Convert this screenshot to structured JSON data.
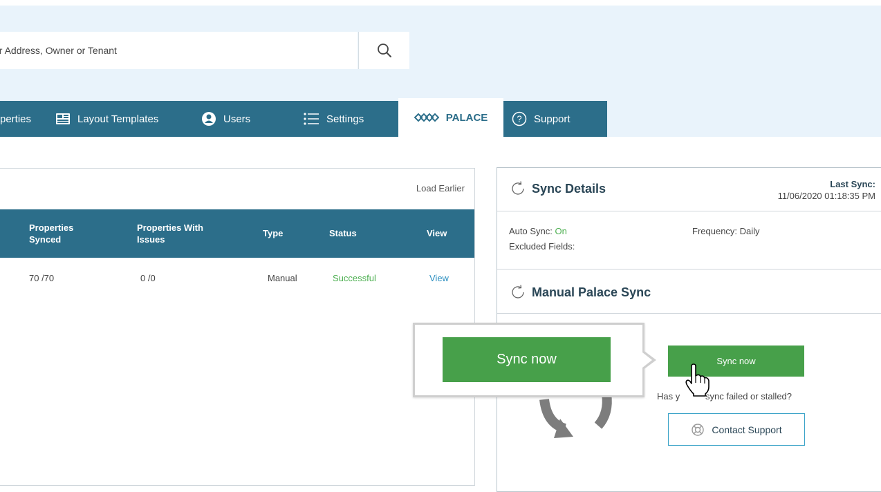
{
  "search": {
    "value": "er Address, Owner or Tenant"
  },
  "nav": {
    "items": [
      {
        "label": "perties"
      },
      {
        "label": "Layout Templates"
      },
      {
        "label": "Users"
      },
      {
        "label": "Settings"
      },
      {
        "label": "PALACE"
      },
      {
        "label": "Support"
      }
    ]
  },
  "history": {
    "load_earlier": "Load Earlier",
    "columns": [
      "Properties Synced",
      "Properties With Issues",
      "Type",
      "Status",
      "View"
    ],
    "rows": [
      {
        "synced": "70 /70",
        "issues": "0 /0",
        "type": "Manual",
        "status": "Successful",
        "view": "View"
      }
    ]
  },
  "sync_details": {
    "title": "Sync Details",
    "last_sync_label": "Last Sync:",
    "last_sync_value": "11/06/2020 01:18:35 PM",
    "auto_sync_label": "Auto Sync:",
    "auto_sync_value": "On",
    "frequency": "Frequency: Daily",
    "excluded_fields": "Excluded Fields:"
  },
  "manual_sync": {
    "title": "Manual Palace Sync",
    "button_label": "Sync now",
    "help_prefix": "Has y",
    "help_suffix": "sync failed or stalled?",
    "contact_label": "Contact Support"
  },
  "callout": {
    "button_label": "Sync now"
  },
  "colors": {
    "nav_bg": "#2c6e8a",
    "accent_green": "#47a04a",
    "success_text": "#4caf50",
    "link": "#2a8ec0",
    "top_band": "#e9f3fb"
  }
}
